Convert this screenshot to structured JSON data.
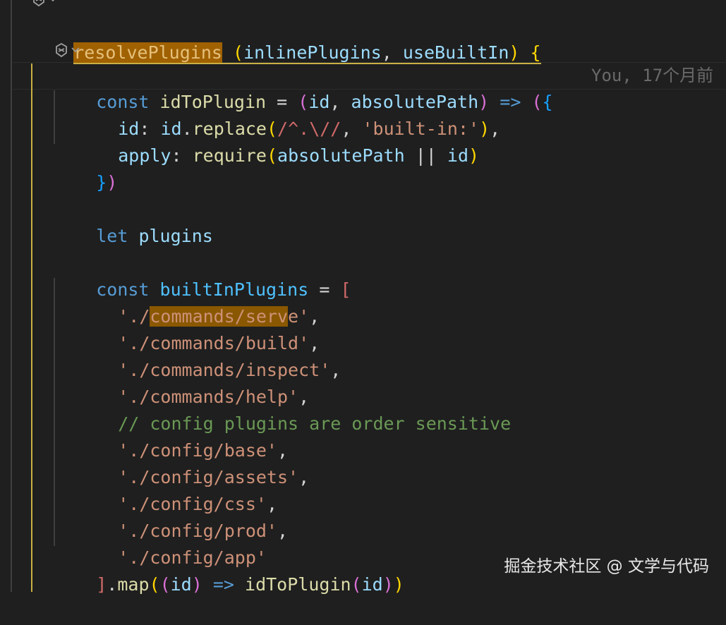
{
  "editor": {
    "codelens_top": "⎇",
    "codelens_mid": "⎇",
    "blame": "You, 17个月前",
    "lines": {
      "l0_fn": "resolvePlugins",
      "l0_open": "(",
      "l0_p1": "inlinePlugins",
      "l0_comma": ",",
      "l0_p2": "useBuiltIn",
      "l0_close": ")",
      "l0_brace": "{",
      "l1_const": "const",
      "l1_name": "idToPlugin",
      "l1_eq": "=",
      "l1_open": "(",
      "l1_id": "id",
      "l1_comma": ",",
      "l1_abs": "absolutePath",
      "l1_close": ")",
      "l1_arrow": "=>",
      "l1_paren": "(",
      "l1_brace": "{",
      "l2_key": "id",
      "l2_colon": ":",
      "l2_obj": "id",
      "l2_dot": ".",
      "l2_fn": "replace",
      "l2_open": "(",
      "l2_regex": "/^.\\//",
      "l2_comma": ",",
      "l2_str": "'built-in:'",
      "l2_close": ")",
      "l2_trail": ",",
      "l3_key": "apply",
      "l3_colon": ":",
      "l3_fn": "require",
      "l3_open": "(",
      "l3_abs": "absolutePath",
      "l3_or": "||",
      "l3_id": "id",
      "l3_close": ")",
      "l4_brace": "}",
      "l4_paren": ")",
      "l6_let": "let",
      "l6_name": "plugins",
      "l8_const": "const",
      "l8_name": "builtInPlugins",
      "l8_eq": "=",
      "l8_bracket": "[",
      "l9_pre": "'./",
      "l9_hl": "commands/serv",
      "l9_post": "e'",
      "l9_comma": ",",
      "l10_str": "'./commands/build'",
      "l10_comma": ",",
      "l11_str": "'./commands/inspect'",
      "l11_comma": ",",
      "l12_str": "'./commands/help'",
      "l12_comma": ",",
      "l13_cmt": "// config plugins are order sensitive",
      "l14_str": "'./config/base'",
      "l14_comma": ",",
      "l15_str": "'./config/assets'",
      "l15_comma": ",",
      "l16_str": "'./config/css'",
      "l16_comma": ",",
      "l17_str": "'./config/prod'",
      "l17_comma": ",",
      "l18_str": "'./config/app'",
      "l19_bracket": "]",
      "l19_dot": ".",
      "l19_map": "map",
      "l19_open": "(",
      "l19_open2": "(",
      "l19_id": "id",
      "l19_close2": ")",
      "l19_arrow": "=>",
      "l19_fn": "idToPlugin",
      "l19_open3": "(",
      "l19_id2": "id",
      "l19_close3": ")",
      "l19_close": ")"
    }
  },
  "watermark": "掘金技术社区 @ 文学与代码",
  "colors": {
    "background": "#1f1f1f",
    "function": "#dcdcaa",
    "keyword": "#569cd6",
    "variable": "#9cdcfe",
    "constant": "#4fc1ff",
    "string": "#ce9178",
    "regex": "#d16969",
    "comment": "#6a9955",
    "highlight": "#a06100",
    "indent_guide_active": "#c9b045"
  }
}
